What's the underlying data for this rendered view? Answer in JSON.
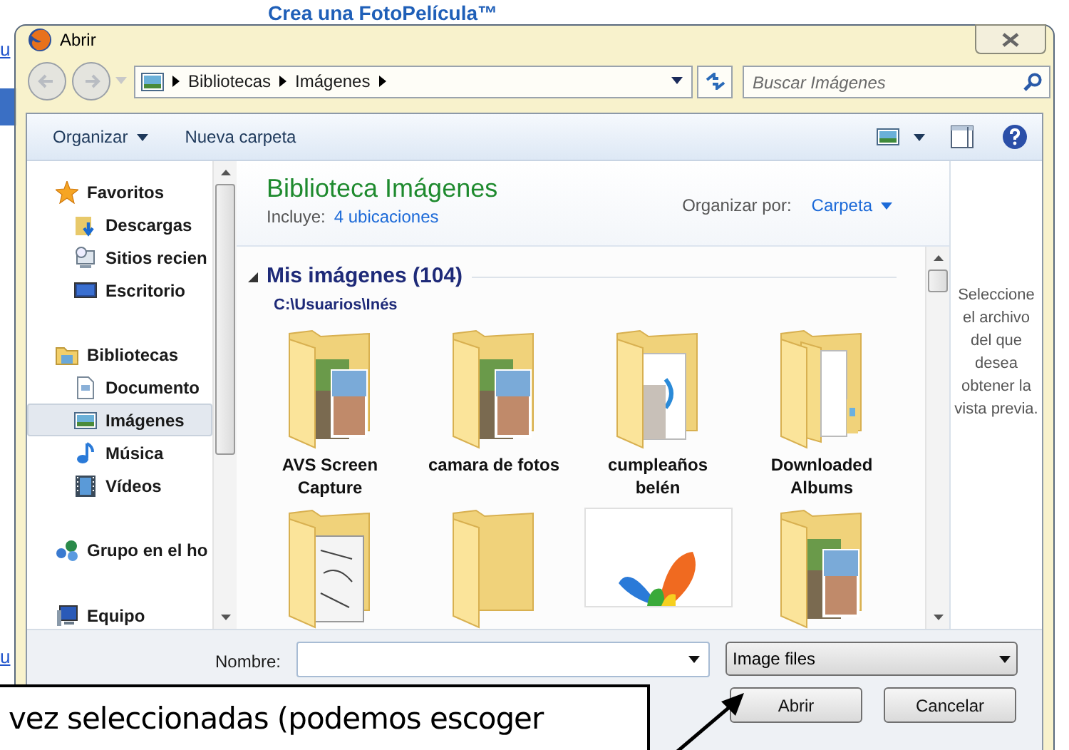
{
  "background": {
    "heading": "Crea una FotoPelícula™",
    "link_fragments": [
      "u",
      "u"
    ]
  },
  "window": {
    "title": "Abrir"
  },
  "address_bar": {
    "path": [
      "Bibliotecas",
      "Imágenes"
    ]
  },
  "search": {
    "placeholder": "Buscar Imágenes"
  },
  "toolbar": {
    "buttons": [
      "Organizar",
      "Nueva carpeta"
    ]
  },
  "sidebar": {
    "groups": [
      {
        "label": "Favoritos",
        "kind": "star",
        "children": [
          {
            "label": "Descargas",
            "kind": "download",
            "selected": false
          },
          {
            "label": "Sitios recien",
            "kind": "recent",
            "selected": false
          },
          {
            "label": "Escritorio",
            "kind": "desktop",
            "selected": false
          }
        ]
      },
      {
        "label": "Bibliotecas",
        "kind": "library",
        "children": [
          {
            "label": "Documento",
            "kind": "document",
            "selected": false
          },
          {
            "label": "Imágenes",
            "kind": "image",
            "selected": true
          },
          {
            "label": "Música",
            "kind": "music",
            "selected": false
          },
          {
            "label": "Vídeos",
            "kind": "video",
            "selected": false
          }
        ]
      },
      {
        "label": "Grupo en el ho",
        "kind": "network"
      },
      {
        "label": "Equipo",
        "kind": "computer"
      }
    ]
  },
  "library": {
    "title": "Biblioteca Imágenes",
    "includes_label": "Incluye:",
    "includes_link": "4 ubicaciones",
    "arrange_label": "Organizar por:",
    "arrange_value": "Carpeta"
  },
  "group": {
    "title": "Mis imágenes (104)",
    "path": "C:\\Usuarios\\Inés",
    "expanded": true,
    "items": [
      {
        "kind": "photos",
        "label": [
          "AVS Screen",
          "Capture"
        ]
      },
      {
        "kind": "photos",
        "label": [
          "camara de fotos"
        ]
      },
      {
        "kind": "documents",
        "label": [
          "cumpleaños",
          "belén"
        ]
      },
      {
        "kind": "files",
        "label": [
          "Downloaded",
          "Albums"
        ]
      },
      {
        "kind": "sketches"
      },
      {
        "kind": "empty"
      },
      {
        "kind": "image"
      },
      {
        "kind": "photos"
      }
    ]
  },
  "preview": {
    "text": "Seleccione el archivo del que desea obtener la vista previa."
  },
  "bottom": {
    "name_label": "Nombre:",
    "file_type": "Image files",
    "buttons": [
      "Abrir",
      "Cancelar"
    ]
  },
  "callout": {
    "text": "vez seleccionadas (podemos escoger"
  }
}
